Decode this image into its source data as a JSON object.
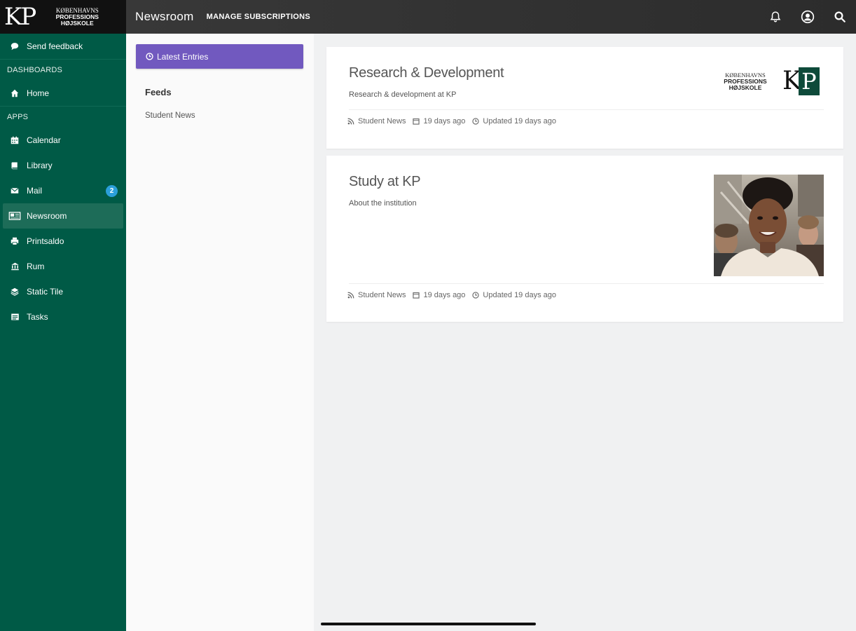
{
  "topbar": {
    "logo_mark": "KP",
    "logo_line1": "KØBENHAVNS",
    "logo_line2": "PROFESSIONS",
    "logo_line3": "HØJSKOLE",
    "title": "Newsroom",
    "manage_label": "MANAGE SUBSCRIPTIONS",
    "icons": [
      "bell-icon",
      "user-icon",
      "search-icon"
    ]
  },
  "sidebar": {
    "feedback_label": "Send feedback",
    "dashboards_heading": "DASHBOARDS",
    "home_label": "Home",
    "apps_heading": "APPS",
    "apps": [
      {
        "label": "Calendar",
        "icon": "calendar-icon"
      },
      {
        "label": "Library",
        "icon": "book-icon"
      },
      {
        "label": "Mail",
        "icon": "mail-icon",
        "badge": "2"
      },
      {
        "label": "Newsroom",
        "icon": "newspaper-icon",
        "active": true
      },
      {
        "label": "Printsaldo",
        "icon": "printer-icon"
      },
      {
        "label": "Rum",
        "icon": "building-icon"
      },
      {
        "label": "Static Tile",
        "icon": "layers-icon"
      },
      {
        "label": "Tasks",
        "icon": "tasks-icon"
      }
    ],
    "colors": {
      "background": "#005a46",
      "active": "#1d6c58",
      "badge": "#2b9fd9"
    }
  },
  "feeds_panel": {
    "latest_label": "Latest Entries",
    "feeds_title": "Feeds",
    "feed_items": [
      "Student News"
    ],
    "accent": "#7159bf"
  },
  "cards": [
    {
      "title": "Research & Development",
      "subtitle": "Research & development at KP",
      "source": "Student News",
      "age": "19 days ago",
      "updated": "Updated 19 days ago",
      "logo_line1": "KØBENHAVNS",
      "logo_line2": "PROFESSIONS",
      "logo_line3": "HØJSKOLE"
    },
    {
      "title": "Study at KP",
      "subtitle": "About the institution",
      "source": "Student News",
      "age": "19 days ago",
      "updated": "Updated 19 days ago"
    }
  ]
}
